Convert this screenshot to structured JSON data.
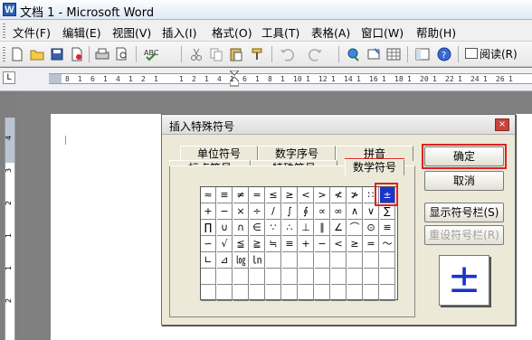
{
  "window": {
    "title": "文档 1 - Microsoft Word",
    "app_icon_letter": "W"
  },
  "menu": {
    "items": [
      "文件(F)",
      "编辑(E)",
      "视图(V)",
      "插入(I)",
      "格式(O)",
      "工具(T)",
      "表格(A)",
      "窗口(W)",
      "帮助(H)"
    ]
  },
  "toolbar": {
    "icons": [
      "new-icon",
      "open-icon",
      "save-icon",
      "permission-icon",
      "print-icon",
      "print-preview-icon",
      "spelling-icon",
      "cut-icon",
      "copy-icon",
      "paste-icon",
      "format-painter-icon",
      "undo-icon",
      "redo-icon",
      "hyperlink-icon",
      "tables-borders-icon",
      "insert-table-icon",
      "document-map-icon",
      "help-icon"
    ],
    "read_label": "阅读(R)"
  },
  "ruler": {
    "corner": "L",
    "labels": [
      "8",
      "1",
      "6",
      "1",
      "4",
      "1",
      "2",
      "1",
      "",
      "1",
      "2",
      "1",
      "4",
      "1",
      "6",
      "1",
      "8",
      "1",
      "10",
      "1",
      "12",
      "1",
      "14",
      "1",
      "16",
      "1",
      "18",
      "1",
      "20",
      "1",
      "22",
      "1",
      "24",
      "1",
      "26",
      "1"
    ],
    "vlabels": [
      "4",
      "3",
      "2",
      "1",
      "1",
      "2"
    ]
  },
  "dialog": {
    "title": "插入特殊符号",
    "close": "×",
    "tabs_back": [
      "单位符号",
      "数字序号",
      "拼音"
    ],
    "tabs_front": [
      "标点符号",
      "特殊符号",
      "数学符号"
    ],
    "selected_tab": "数学符号",
    "symbols": [
      [
        "≈",
        "≡",
        "≠",
        "=",
        "≤",
        "≥",
        "<",
        ">",
        "≮",
        "≯",
        "∷",
        "±"
      ],
      [
        "+",
        "−",
        "×",
        "÷",
        "/",
        "∫",
        "∮",
        "∝",
        "∞",
        "∧",
        "∨",
        "∑"
      ],
      [
        "∏",
        "∪",
        "∩",
        "∈",
        "∵",
        "∴",
        "⊥",
        "∥",
        "∠",
        "⌒",
        "⊙",
        "≌"
      ],
      [
        "∽",
        "√",
        "≦",
        "≧",
        "≒",
        "≡",
        "+",
        "−",
        "<",
        "≥",
        "=",
        "～"
      ],
      [
        "∟",
        "⊿",
        "㏒",
        "㏑",
        "",
        "",
        "",
        "",
        "",
        "",
        "",
        ""
      ],
      [
        "",
        "",
        "",
        "",
        "",
        "",
        "",
        "",
        "",
        "",
        "",
        ""
      ],
      [
        "",
        "",
        "",
        "",
        "",
        "",
        "",
        "",
        "",
        "",
        "",
        ""
      ]
    ],
    "selected_symbol": "±",
    "buttons": {
      "ok": "确定",
      "cancel": "取消",
      "show_bar": "显示符号栏(S)",
      "reset_bar": "重设符号栏(R)"
    },
    "preview": "±"
  }
}
